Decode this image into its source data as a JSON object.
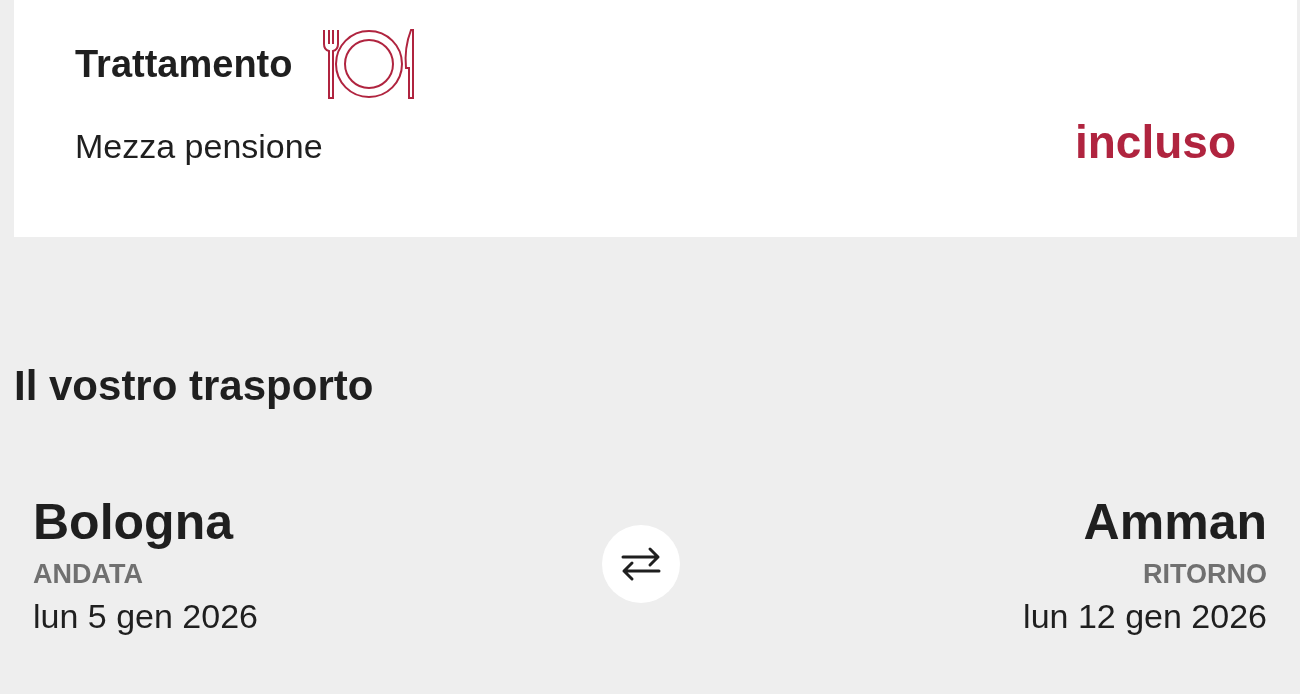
{
  "meal": {
    "title": "Trattamento",
    "board": "Mezza pensione",
    "status": "incluso"
  },
  "transport": {
    "title": "Il vostro trasporto",
    "legs": [
      {
        "city": "Bologna",
        "label": "ANDATA",
        "date": "lun 5 gen 2026"
      },
      {
        "city": "Amman",
        "label": "RITORNO",
        "date": "lun 12 gen 2026"
      }
    ]
  }
}
